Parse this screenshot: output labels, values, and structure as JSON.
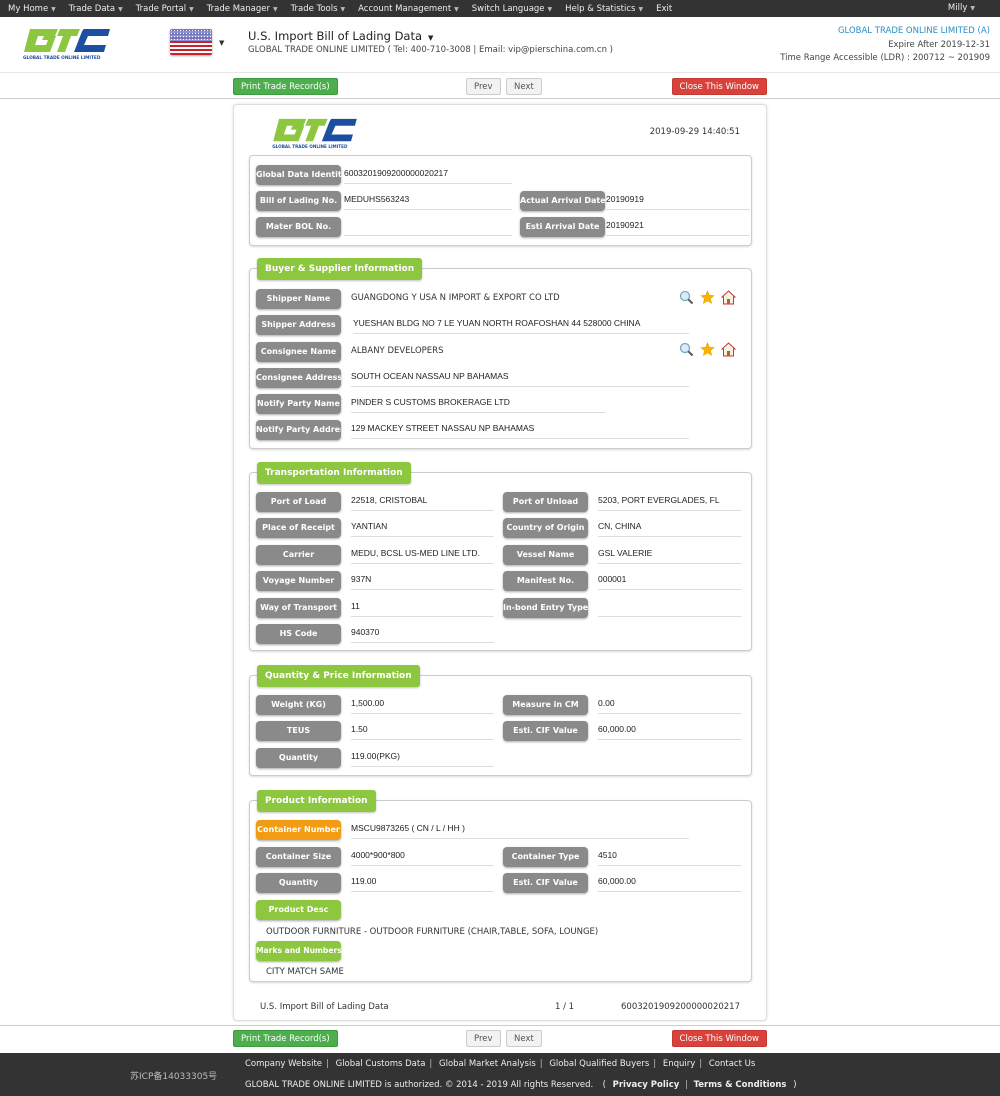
{
  "topnav": {
    "items": [
      "My Home",
      "Trade Data",
      "Trade Portal",
      "Trade Manager",
      "Trade Tools",
      "Account Management",
      "Switch Language",
      "Help & Statistics",
      "Exit"
    ],
    "user": "Milly"
  },
  "header": {
    "logo_text": "GLOBAL TRADE ONLINE LIMITED",
    "title": "U.S. Import Bill of Lading Data",
    "subtitle": "GLOBAL TRADE ONLINE LIMITED ( Tel: 400-710-3008 | Email: vip@pierschina.com.cn )",
    "company": "GLOBAL TRADE ONLINE LIMITED (A)",
    "expire": "Expire After 2019-12-31",
    "range": "Time Range Accessible (LDR) : 200712 ~ 201909"
  },
  "buttons": {
    "print": "Print Trade Record(s)",
    "prev": "Prev",
    "next": "Next",
    "close": "Close This Window"
  },
  "card": {
    "logo_text": "GLOBAL TRADE ONLINE LIMITED",
    "datetime": "2019-09-29 14:40:51"
  },
  "identity": {
    "global_data_identity": {
      "label": "Global Data Identity",
      "value": "6003201909200000020217"
    },
    "bill_of_lading": {
      "label": "Bill of Lading No.",
      "value": "MEDUHS563243"
    },
    "actual_arrival": {
      "label": "Actual Arrival Date",
      "value": "20190919"
    },
    "master_bol": {
      "label": "Mater BOL No.",
      "value": ""
    },
    "esti_arrival": {
      "label": "Esti Arrival Date",
      "value": "20190921"
    }
  },
  "buyer_supplier": {
    "title": "Buyer & Supplier Information",
    "shipper_name": {
      "label": "Shipper Name",
      "value": "GUANGDONG Y USA N IMPORT & EXPORT CO LTD"
    },
    "shipper_address": {
      "label": "Shipper Address",
      "value": "YUESHAN BLDG NO 7 LE YUAN NORTH ROAFOSHAN 44 528000 CHINA"
    },
    "consignee_name": {
      "label": "Consignee Name",
      "value": "ALBANY DEVELOPERS"
    },
    "consignee_address": {
      "label": "Consignee Address",
      "value": "SOUTH OCEAN NASSAU NP BAHAMAS"
    },
    "notify_name": {
      "label": "Notify Party Name",
      "value": "PINDER S CUSTOMS BROKERAGE LTD"
    },
    "notify_address": {
      "label": "Notify Party Address",
      "value": "129 MACKEY STREET NASSAU NP BAHAMAS"
    }
  },
  "transport": {
    "title": "Transportation Information",
    "port_of_load": {
      "label": "Port of Load",
      "value": "22518, CRISTOBAL"
    },
    "port_of_unload": {
      "label": "Port of Unload",
      "value": "5203, PORT EVERGLADES, FL"
    },
    "place_of_receipt": {
      "label": "Place of Receipt",
      "value": "YANTIAN"
    },
    "country_of_origin": {
      "label": "Country of Origin",
      "value": "CN, CHINA"
    },
    "carrier": {
      "label": "Carrier",
      "value": "MEDU, BCSL US-MED LINE LTD."
    },
    "vessel_name": {
      "label": "Vessel Name",
      "value": "GSL VALERIE"
    },
    "voyage_number": {
      "label": "Voyage Number",
      "value": "937N"
    },
    "manifest_no": {
      "label": "Manifest No.",
      "value": "000001"
    },
    "way_of_transport": {
      "label": "Way of Transport",
      "value": "11"
    },
    "inbond_entry_type": {
      "label": "In-bond Entry Type",
      "value": ""
    },
    "hs_code": {
      "label": "HS Code",
      "value": "940370"
    }
  },
  "quantity_price": {
    "title": "Quantity & Price Information",
    "weight": {
      "label": "Weight (KG)",
      "value": "1,500.00"
    },
    "measure": {
      "label": "Measure in CM",
      "value": "0.00"
    },
    "teus": {
      "label": "TEUS",
      "value": "1.50"
    },
    "cif_value": {
      "label": "Esti. CIF Value",
      "value": "60,000.00"
    },
    "quantity": {
      "label": "Quantity",
      "value": "119.00(PKG)"
    }
  },
  "product": {
    "title": "Product Information",
    "container_number": {
      "label": "Container Number",
      "value": "MSCU9873265 ( CN / L / HH )"
    },
    "container_size": {
      "label": "Container Size",
      "value": "4000*900*800"
    },
    "container_type": {
      "label": "Container Type",
      "value": "4510"
    },
    "quantity": {
      "label": "Quantity",
      "value": "119.00"
    },
    "cif_value": {
      "label": "Esti. CIF Value",
      "value": "60,000.00"
    },
    "product_desc": {
      "label": "Product Desc",
      "value": "OUTDOOR FURNITURE - OUTDOOR FURNITURE (CHAIR,TABLE, SOFA, LOUNGE)"
    },
    "marks_numbers": {
      "label": "Marks and Numbers",
      "value": "CITY MATCH SAME"
    }
  },
  "card_footer": {
    "left": "U.S. Import Bill of Lading Data",
    "page": "1 / 1",
    "id": "6003201909200000020217"
  },
  "footer": {
    "icp": "苏ICP备14033305号",
    "links": [
      "Company Website",
      "Global Customs Data",
      "Global Market Analysis",
      "Global Qualified Buyers",
      "Enquiry",
      "Contact Us"
    ],
    "copyright": "GLOBAL TRADE ONLINE LIMITED is authorized. © 2014 - 2019 All rights Reserved.",
    "privacy": "Privacy Policy",
    "terms": "Terms & Conditions"
  },
  "colors": {
    "nav_bg": "#333333",
    "accent_green": "#8dc63f",
    "print_green": "#4cae4c",
    "close_red": "#d9413a",
    "label_gray": "#8a8a8a",
    "label_orange": "#f39c12",
    "company_blue": "#2a8fc4"
  }
}
